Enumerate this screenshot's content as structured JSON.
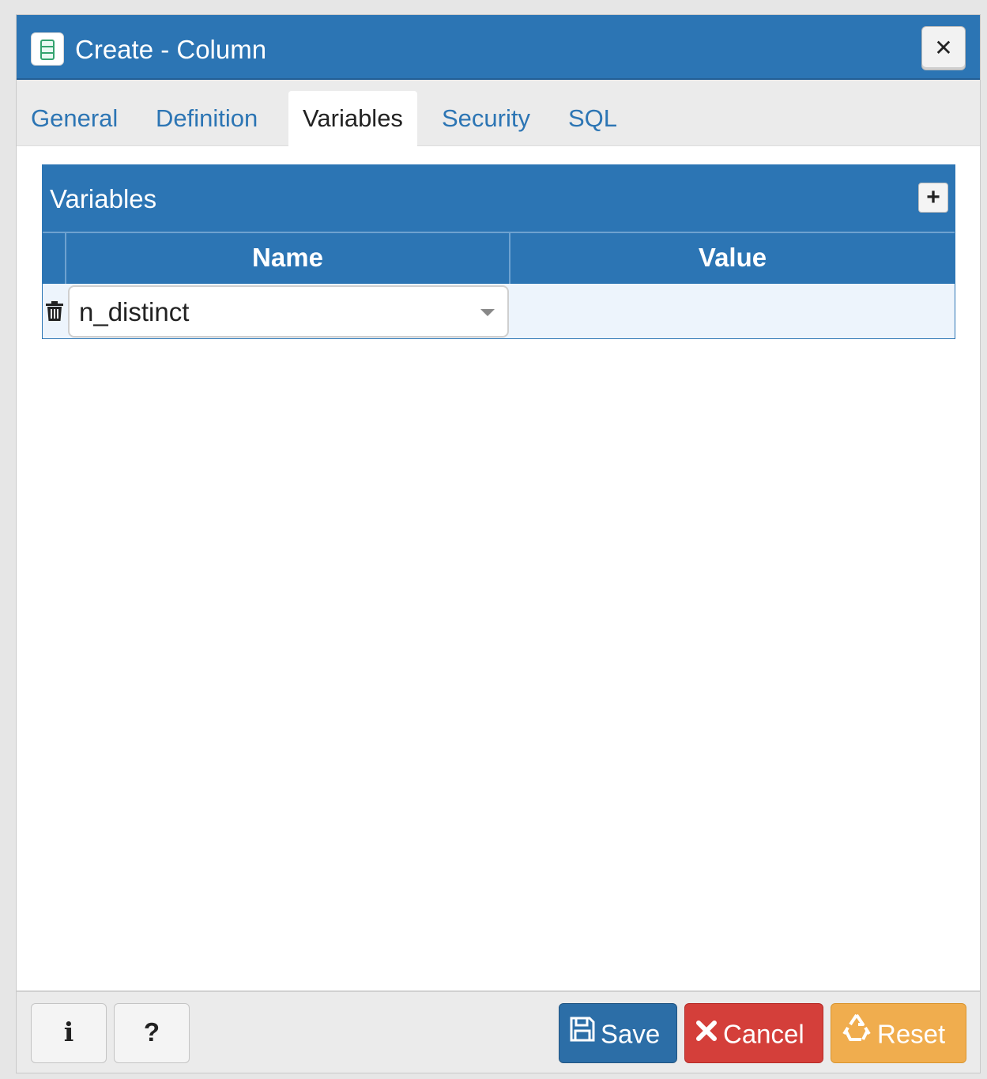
{
  "dialog": {
    "title": "Create - Column",
    "title_icon": "column-icon",
    "close_icon": "close-icon"
  },
  "tabs": [
    {
      "label": "General",
      "active": false
    },
    {
      "label": "Definition",
      "active": false
    },
    {
      "label": "Variables",
      "active": true
    },
    {
      "label": "Security",
      "active": false
    },
    {
      "label": "SQL",
      "active": false
    }
  ],
  "variables": {
    "title": "Variables",
    "add_icon": "plus-icon",
    "columns": {
      "name": "Name",
      "value": "Value"
    },
    "rows": [
      {
        "name": "n_distinct",
        "value": ""
      }
    ]
  },
  "footer": {
    "info_label": "i",
    "help_label": "?",
    "save_label": "Save",
    "cancel_label": "Cancel",
    "reset_label": "Reset"
  },
  "colors": {
    "primary": "#2c75b4",
    "save": "#2c6ea7",
    "cancel": "#d43f3a",
    "reset": "#f0ad4e"
  }
}
